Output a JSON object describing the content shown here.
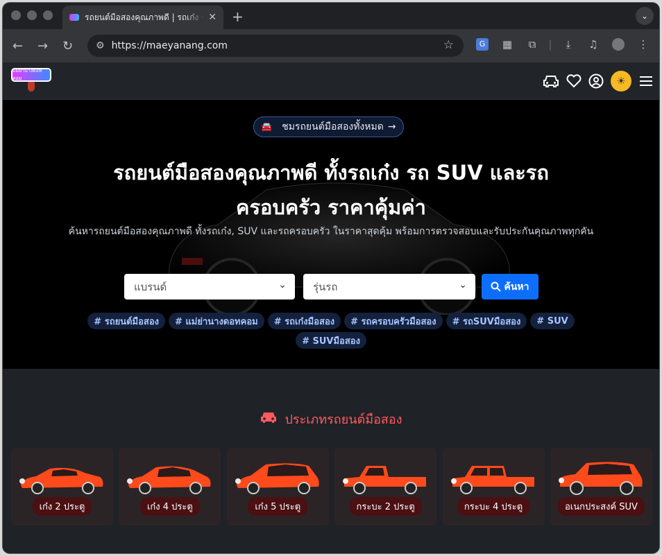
{
  "browser": {
    "tab_title": "รถยนต์มือสองคุณภาพดี | รถเก๋ง รถ SUV",
    "tab_close": "✕",
    "new_tab": "+",
    "url": "https://maeyanang.com"
  },
  "site": {
    "logo_text": "แม่ย่านางดอทคอม",
    "theme_icon": "☀"
  },
  "hero": {
    "pill_label": "ชมรถยนต์มือสองทั้งหมด",
    "pill_arrow": "→",
    "title": "รถยนต์มือสองคุณภาพดี ทั้งรถเก๋ง รถ SUV และรถครอบครัว ราคาคุ้มค่า",
    "subtitle": "ค้นหารถยนต์มือสองคุณภาพดี ทั้งรถเก๋ง, SUV และรถครอบครัว ในราคาสุดคุ้ม พร้อมการตรวจสอบและรับประกันคุณภาพทุกคัน",
    "brand_placeholder": "แบรนด์",
    "model_placeholder": "รุ่นรถ",
    "search_label": "ค้นหา",
    "tags": [
      "# รถยนต์มือสอง",
      "# แม่ย่านางดอทคอม",
      "# รถเก๋งมือสอง",
      "# รถครอบครัวมือสอง",
      "# รถSUVมือสอง",
      "# SUV",
      "# SUVมือสอง"
    ]
  },
  "categories": {
    "title": "ประเภทรถยนต์มือสอง",
    "items": [
      {
        "label": "เก๋ง 2 ประตู",
        "shape": "coupe"
      },
      {
        "label": "เก๋ง 4 ประตู",
        "shape": "sedan"
      },
      {
        "label": "เก๋ง 5 ประตู",
        "shape": "hatch"
      },
      {
        "label": "กระบะ 2 ประตู",
        "shape": "pickup2"
      },
      {
        "label": "กระบะ 4 ประตู",
        "shape": "pickup4"
      },
      {
        "label": "อเนกประสงค์ SUV",
        "shape": "suv"
      }
    ]
  },
  "colors": {
    "accent": "#0d6efd",
    "car": "#ff4a1c",
    "section_title": "#ff5a5f"
  }
}
